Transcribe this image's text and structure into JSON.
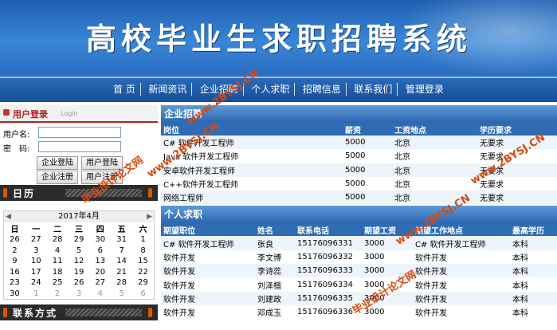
{
  "site": {
    "title": "高校毕业生求职招聘系统"
  },
  "nav": [
    "首 页",
    "新闻资讯",
    "企业招聘",
    "个人求职",
    "招聘信息",
    "联系我们",
    "管理登录"
  ],
  "login": {
    "heading": "用户登录",
    "heading_sub": "Login",
    "username_label": "用户名:",
    "password_label": "密　码:",
    "buttons": [
      "企业登陆",
      "用户登陆",
      "企业注册",
      "用户注册"
    ]
  },
  "calendar_panel": {
    "heading": "日历"
  },
  "calendar": {
    "month_label": "2017年4月",
    "weekdays": [
      "日",
      "一",
      "二",
      "三",
      "四",
      "五",
      "六"
    ],
    "weeks": [
      [
        "26",
        "27",
        "28",
        "29",
        "30",
        "31",
        "1"
      ],
      [
        "2",
        "3",
        "4",
        "5",
        "6",
        "7",
        "8"
      ],
      [
        "9",
        "10",
        "11",
        "12",
        "13",
        "14",
        "15"
      ],
      [
        "16",
        "17",
        "18",
        "19",
        "20",
        "21",
        "22"
      ],
      [
        "23",
        "24",
        "25",
        "26",
        "27",
        "28",
        "29"
      ],
      [
        "30",
        "1",
        "2",
        "3",
        "4",
        "5",
        "6"
      ]
    ]
  },
  "contact_panel": {
    "heading": "联系方式"
  },
  "jobs": {
    "heading": "企业招聘",
    "columns": [
      "岗位",
      "薪资",
      "工资地点",
      "学历要求"
    ],
    "rows": [
      [
        "C# 软件开发工程师",
        "5000",
        "北京",
        "无要求"
      ],
      [
        "Java 软件开发工程师",
        "5000",
        "北京",
        "无要求"
      ],
      [
        "安卓软件开发工程师",
        "5000",
        "北京",
        "无要求"
      ],
      [
        "C++软件开发工程师",
        "5000",
        "北京",
        "无要求"
      ],
      [
        "网络工程师",
        "5000",
        "北京",
        "无要求"
      ]
    ]
  },
  "seekers": {
    "heading": "个人求职",
    "columns": [
      "期望职位",
      "姓名",
      "联系电话",
      "期望工资",
      "期望工作地点",
      "最高学历"
    ],
    "rows": [
      [
        "C# 软件开发工程师",
        "张良",
        "15176096331",
        "3000",
        "C# 软件开发工程师",
        "本科"
      ],
      [
        "软件开发",
        "李文博",
        "15176096332",
        "3000",
        "软件开发",
        "本科"
      ],
      [
        "软件开发",
        "李诗蕊",
        "15176096333",
        "3000",
        "软件开发",
        "本科"
      ],
      [
        "软件开发",
        "刘泽楷",
        "15176096334",
        "3000",
        "软件开发",
        "本科"
      ],
      [
        "软件开发",
        "刘建政",
        "15176096335",
        "3000",
        "软件开发",
        "本科"
      ],
      [
        "软件开发",
        "邓成玉",
        "15176096336",
        "3000",
        "软件开发",
        "本科"
      ]
    ]
  },
  "watermarks": [
    "毕业设计论文网",
    "www.2BYSJ.CN"
  ]
}
